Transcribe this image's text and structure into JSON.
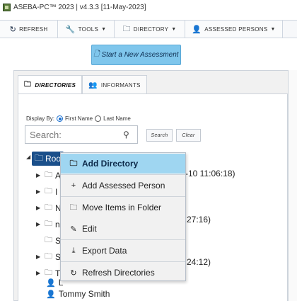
{
  "titlebar": {
    "text": "ASEBA-PC™ 2023 | v4.3.3 [11-May-2023]",
    "icon": "app-logo-icon"
  },
  "toolbar": {
    "refresh": "REFRESH",
    "tools": "TOOLS",
    "directory": "DIRECTORY",
    "assessed": "ASSESSED PERSONS"
  },
  "start_button": "Start a New Assessment",
  "tabs": {
    "directories": "DIRECTORIES",
    "informants": "INFORMANTS"
  },
  "display_by": {
    "label": "Display By:",
    "first": "First Name",
    "last": "Last Name",
    "selected": "First Name"
  },
  "search": {
    "placeholder": "Search:",
    "search_btn": "Search",
    "clear_btn": "Clear"
  },
  "tree": {
    "root": "Roo",
    "rows": [
      {
        "prefix": "A",
        "tail": "-10 11:06:18)"
      },
      {
        "prefix": "I",
        "tail": ""
      },
      {
        "prefix": "N",
        "tail": ""
      },
      {
        "prefix": "n",
        "tail": "27:16)"
      },
      {
        "prefix": "S",
        "tail": ""
      },
      {
        "prefix": "S",
        "tail": ""
      },
      {
        "prefix": "T",
        "tail": "24:12)"
      },
      {
        "prefix": "L",
        "tail": ""
      }
    ],
    "last_person": "Tommy Smith"
  },
  "context_menu": {
    "add_directory": "Add Directory",
    "add_person": "Add Assessed Person",
    "move_items": "Move Items in Folder",
    "edit": "Edit",
    "export": "Export Data",
    "refresh": "Refresh Directories"
  },
  "colors": {
    "accent": "#7fc6ec",
    "highlight": "#9fd6f1",
    "root_bg": "#1a4f8a"
  }
}
